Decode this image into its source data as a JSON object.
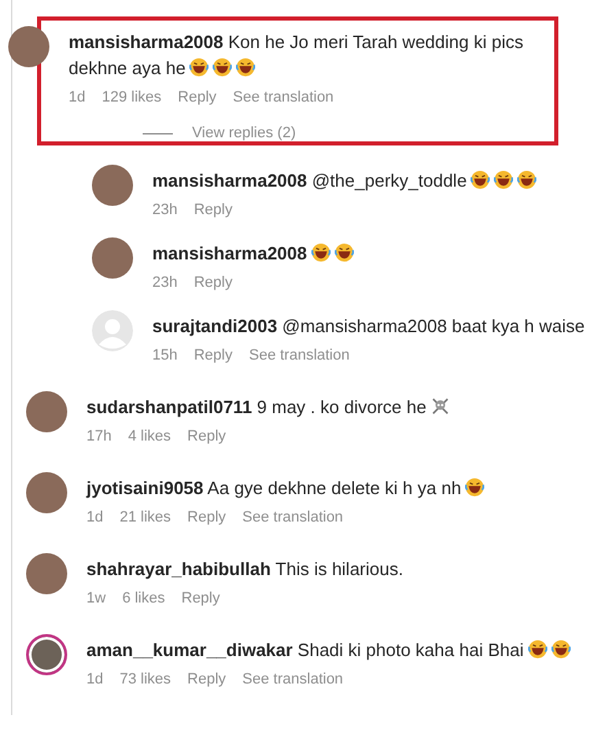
{
  "comments": [
    {
      "username": "mansisharma2008",
      "text": "Kon he Jo meri Tarah wedding ki pics dekhne aya he",
      "emojis": [
        {
          "kind": "laugh"
        },
        {
          "kind": "laugh"
        },
        {
          "kind": "laugh"
        }
      ],
      "avatar": {
        "kind": "photo",
        "story_ring": false
      },
      "highlighted": true,
      "time": "1d",
      "likes": "129 likes",
      "reply": "Reply",
      "translation": "See translation",
      "view_replies": "View replies (2)",
      "replies": [
        {
          "username": "mansisharma2008",
          "text": "@the_perky_toddle",
          "emojis": [
            {
              "kind": "laugh"
            },
            {
              "kind": "laugh"
            },
            {
              "kind": "laugh"
            }
          ],
          "avatar": {
            "kind": "photo",
            "story_ring": false
          },
          "time": "23h",
          "reply": "Reply"
        },
        {
          "username": "mansisharma2008",
          "emojis": [
            {
              "kind": "laugh"
            },
            {
              "kind": "laugh"
            }
          ],
          "avatar": {
            "kind": "photo",
            "story_ring": false
          },
          "time": "23h",
          "reply": "Reply"
        },
        {
          "username": "surajtandi2003",
          "text": "@mansisharma2008 baat kya h waise",
          "avatar": {
            "kind": "default",
            "story_ring": false
          },
          "time": "15h",
          "reply": "Reply",
          "translation": "See translation"
        }
      ]
    },
    {
      "username": "sudarshanpatil0711",
      "text": "9 may . ko divorce he",
      "emojis": [
        {
          "kind": "skull"
        }
      ],
      "avatar": {
        "kind": "photo",
        "story_ring": false
      },
      "highlighted": false,
      "time": "17h",
      "likes": "4 likes",
      "reply": "Reply"
    },
    {
      "username": "jyotisaini9058",
      "text": "Aa gye dekhne delete ki h ya nh",
      "emojis": [
        {
          "kind": "laugh"
        }
      ],
      "avatar": {
        "kind": "photo",
        "story_ring": false
      },
      "highlighted": false,
      "time": "1d",
      "likes": "21 likes",
      "reply": "Reply",
      "translation": "See translation"
    },
    {
      "username": "shahrayar_habibullah",
      "text": "This is hilarious.",
      "avatar": {
        "kind": "photo",
        "story_ring": false
      },
      "highlighted": false,
      "time": "1w",
      "likes": "6 likes",
      "reply": "Reply"
    },
    {
      "username": "aman__kumar__diwakar",
      "text": "Shadi ki photo kaha hai Bhai",
      "emojis": [
        {
          "kind": "laugh"
        },
        {
          "kind": "laugh"
        }
      ],
      "avatar": {
        "kind": "photo",
        "story_ring": true
      },
      "highlighted": false,
      "time": "1d",
      "likes": "73 likes",
      "reply": "Reply",
      "translation": "See translation"
    }
  ]
}
